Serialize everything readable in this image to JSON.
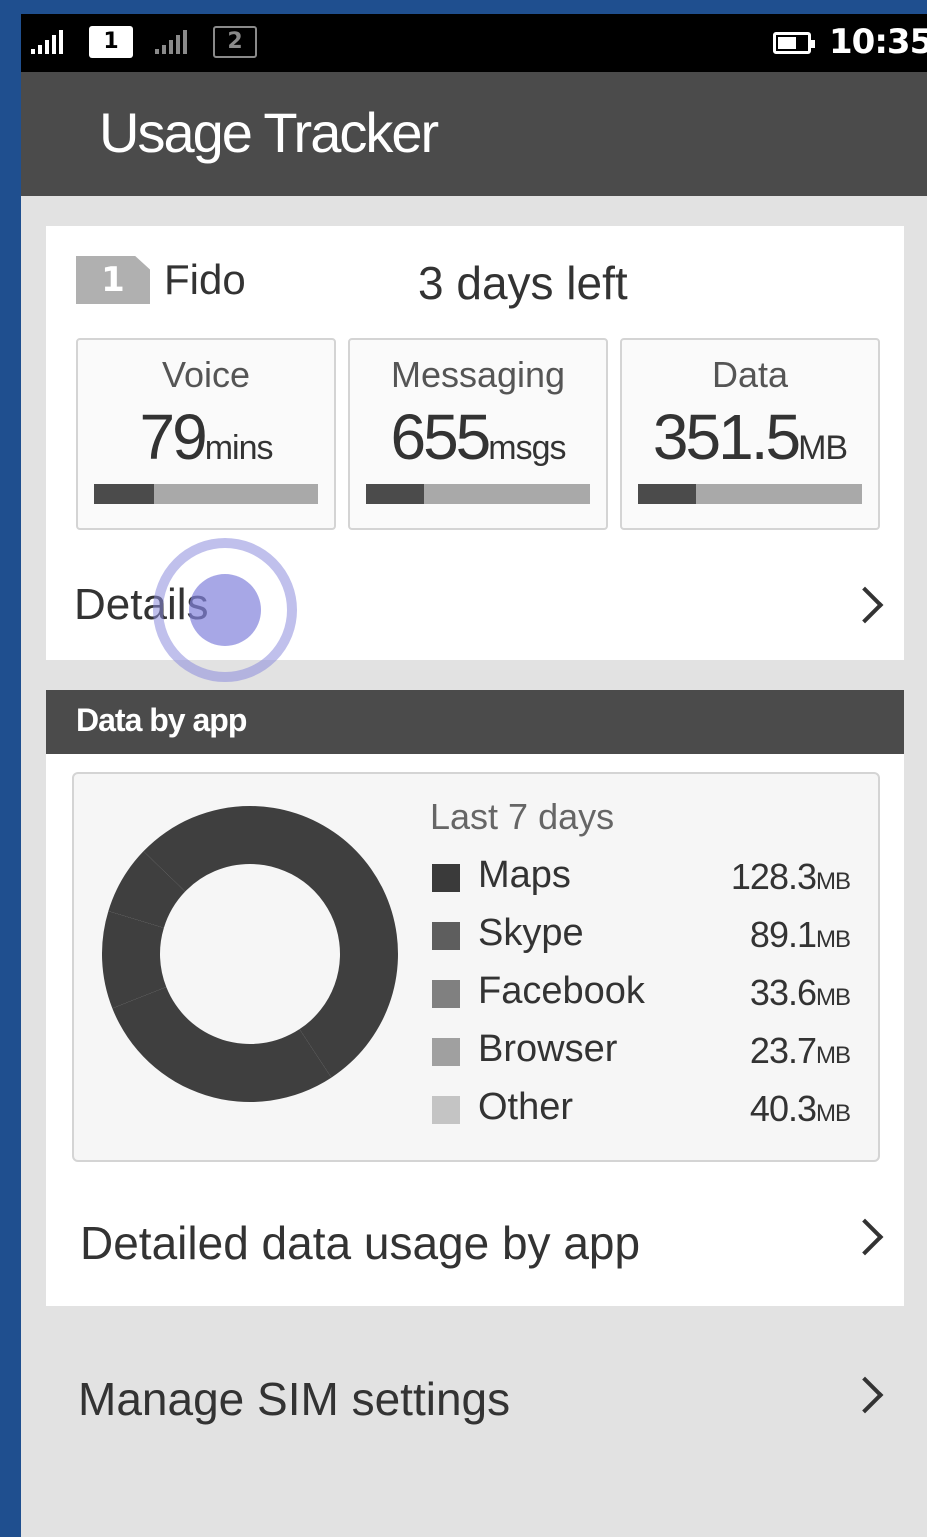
{
  "status_bar": {
    "sim1_label": "1",
    "sim2_label": "2",
    "time": "10:35"
  },
  "app": {
    "title": "Usage Tracker"
  },
  "sim_card": {
    "sim_number": "1",
    "carrier": "Fido",
    "days_left": "3 days left",
    "tiles": [
      {
        "label": "Voice",
        "value": "79",
        "unit": "mins",
        "used_fraction": 0.27
      },
      {
        "label": "Messaging",
        "value": "655",
        "unit": "msgs",
        "used_fraction": 0.26
      },
      {
        "label": "Data",
        "value": "351.5",
        "unit": "MB",
        "used_fraction": 0.26
      }
    ],
    "details_label": "Details"
  },
  "data_by_app": {
    "header": "Data by app",
    "period": "Last 7 days",
    "detailed_label": "Detailed data usage by app"
  },
  "chart_data": {
    "type": "pie",
    "title": "Last 7 days",
    "unit": "MB",
    "categories": [
      "Maps",
      "Skype",
      "Facebook",
      "Browser",
      "Other"
    ],
    "values": [
      128.3,
      89.1,
      33.6,
      23.7,
      40.3
    ],
    "colors": [
      "#3a3a3a",
      "#5e5e5e",
      "#808080",
      "#a0a0a0",
      "#c4c4c4"
    ],
    "donut": true,
    "legend_placement": "right"
  },
  "manage_sim": {
    "label": "Manage SIM settings"
  }
}
